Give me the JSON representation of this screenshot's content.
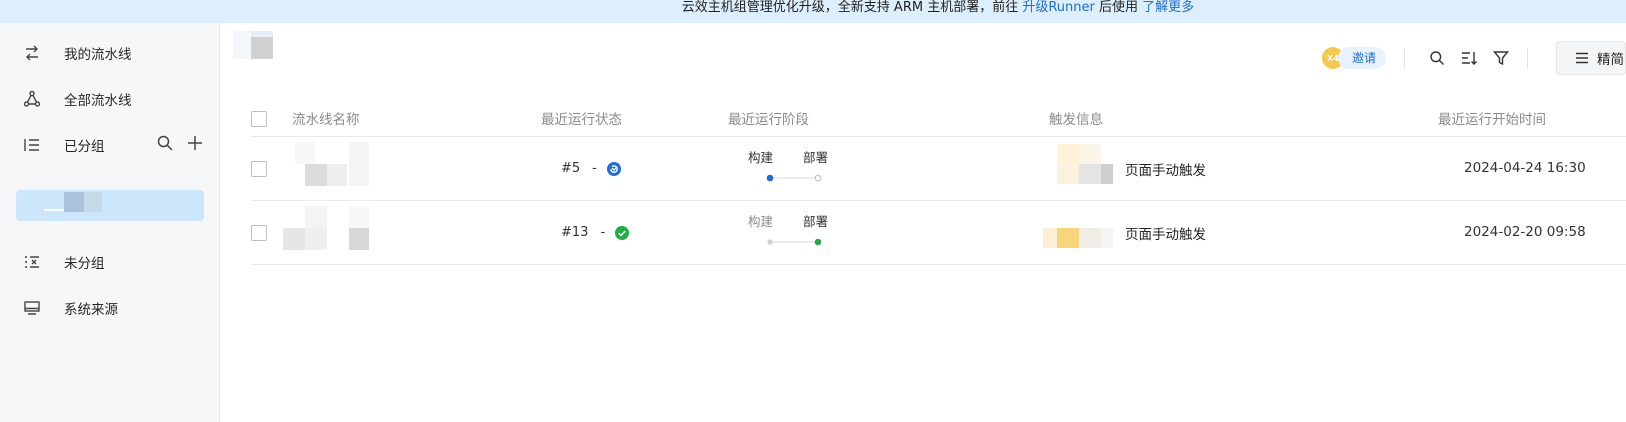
{
  "banner": {
    "text": "云效主机组管理优化升级，全新支持 ARM 主机部署，前往",
    "link1": "升级Runner",
    "middle": "后使用",
    "link2": "了解更多"
  },
  "sidebar": {
    "items": [
      {
        "label": "我的流水线",
        "icon": "swap-icon"
      },
      {
        "label": "全部流水线",
        "icon": "nodes-icon"
      },
      {
        "label": "已分组",
        "icon": "list-icon"
      },
      {
        "label": "未分组",
        "icon": "list-x-icon"
      },
      {
        "label": "系统来源",
        "icon": "monitor-icon"
      }
    ]
  },
  "toolbar": {
    "avatar_text": "X4",
    "invite_label": "邀请",
    "view_label": "精简"
  },
  "table": {
    "columns": [
      "流水线名称",
      "最近运行状态",
      "最近运行阶段",
      "触发信息",
      "最近运行开始时间"
    ],
    "rows": [
      {
        "run_no": "#5",
        "dash": "-",
        "status": "running",
        "stages": [
          "构建",
          "部署"
        ],
        "trigger": "页面手动触发",
        "start_time": "2024-04-24 16:30"
      },
      {
        "run_no": "#13",
        "dash": "-",
        "status": "success",
        "stages": [
          "构建",
          "部署"
        ],
        "trigger": "页面手动触发",
        "start_time": "2024-02-20 09:58"
      }
    ]
  },
  "colors": {
    "accent": "#1b6fd6",
    "success": "#1fad46",
    "running": "#1b6fd6",
    "banner_bg": "#ddeefc",
    "sidebar_bg": "#f6f7f9"
  }
}
